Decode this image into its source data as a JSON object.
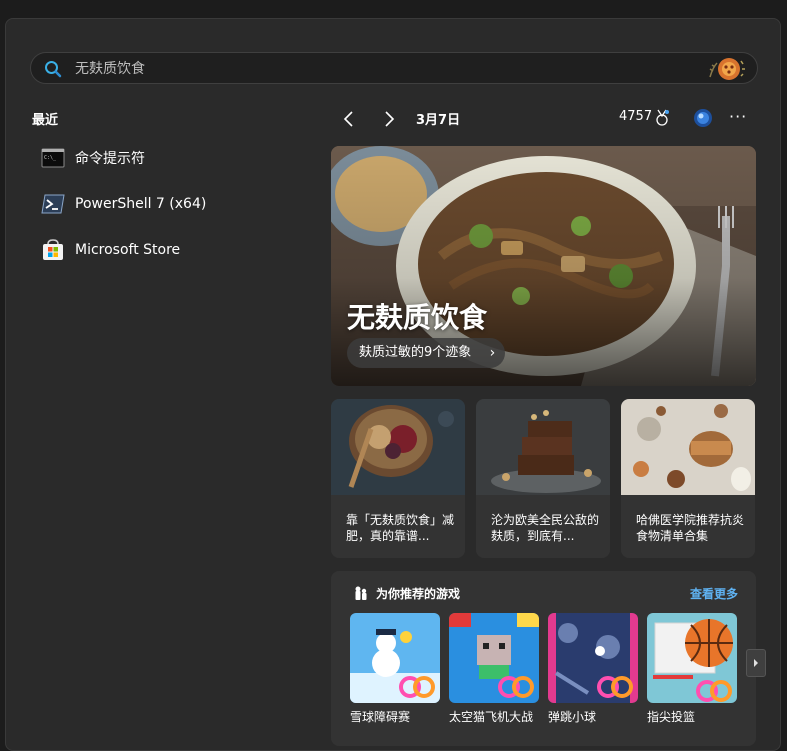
{
  "search": {
    "placeholder": "无麸质饮食"
  },
  "recent": {
    "title": "最近",
    "items": [
      {
        "label": "命令提示符",
        "icon": "cmd-icon"
      },
      {
        "label": "PowerShell 7 (x64)",
        "icon": "powershell-icon"
      },
      {
        "label": "Microsoft Store",
        "icon": "store-icon"
      }
    ]
  },
  "nav": {
    "date": "3月7日",
    "points": "4757",
    "more": "···"
  },
  "hero": {
    "title": "无麸质饮食",
    "pill": "麸质过敏的9个迹象"
  },
  "cards": [
    {
      "text": "靠「无麸质饮食」减肥，真的靠谱..."
    },
    {
      "text": "沦为欧美全民公敌的麸质，到底有..."
    },
    {
      "text": "哈佛医学院推荐抗炎食物清单合集"
    }
  ],
  "games": {
    "title": "为你推荐的游戏",
    "see_more": "查看更多",
    "items": [
      {
        "name": "雪球障碍赛"
      },
      {
        "name": "太空猫飞机大战"
      },
      {
        "name": "弹跳小球"
      },
      {
        "name": "指尖投篮"
      }
    ]
  },
  "colors": {
    "accent": "#5fb2f2",
    "panel": "#2a2a2a",
    "card": "#333333"
  }
}
